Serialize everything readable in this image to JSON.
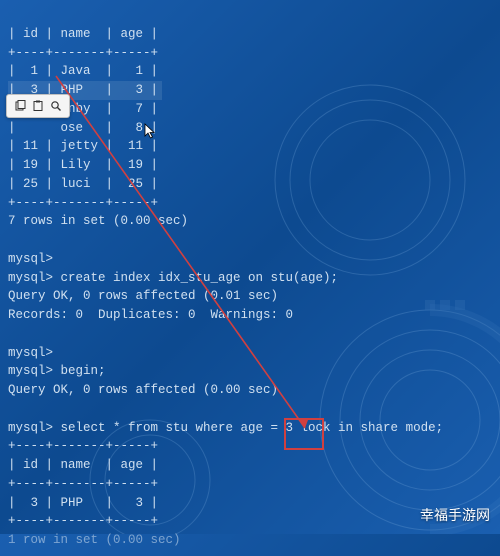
{
  "term": {
    "header": "| id | name  | age |",
    "sep": "+----+-------+-----+",
    "rows": [
      "|  1 | Java  |   1 |",
      "|  3 | PHP   |   3 |",
      "|       nby  |   7 |",
      "|      ose   |   8 |",
      "| 11 | jetty |  11 |",
      "| 19 | Lily  |  19 |",
      "| 25 | luci  |  25 |"
    ],
    "footer": "7 rows in set (0.00 sec)",
    "blank": "",
    "p1": "mysql>",
    "l1": "mysql> create index idx_stu_age on stu(age);",
    "l2": "Query OK, 0 rows affected (0.01 sec)",
    "l3": "Records: 0  Duplicates: 0  Warnings: 0",
    "p2": "mysql>",
    "l4": "mysql> begin;",
    "l5": "Query OK, 0 rows affected (0.00 sec)",
    "l6": "mysql> select * from stu where age = 3 lock in share mode;",
    "sep2": "+----+-------+-----+",
    "hdr2": "| id | name  | age |",
    "row2": "|  3 | PHP   |   3 |",
    "ftr2": "1 row in set (0.00 sec)"
  },
  "toolbar": {
    "copy": "copy-icon",
    "paste": "paste-icon",
    "search": "search-icon"
  },
  "watermark": "幸福手游网"
}
